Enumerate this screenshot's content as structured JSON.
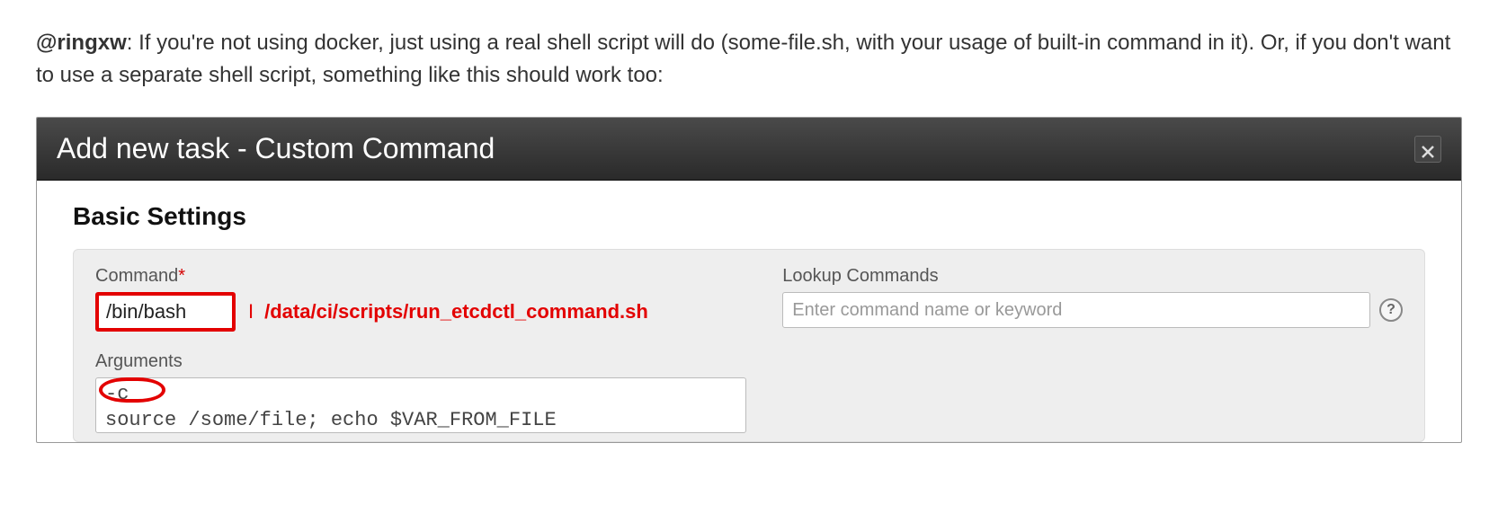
{
  "comment": {
    "mention": "@ringxw",
    "text": ": If you're not using docker, just using a real shell script will do (some-file.sh, with your usage of built-in command in it). Or, if you don't want to use a separate shell script, something like this should work too:"
  },
  "dialog": {
    "title": "Add new task - Custom Command",
    "section_title": "Basic Settings",
    "fields": {
      "command": {
        "label": "Command",
        "required_marker": "*",
        "value": "/bin/bash",
        "annotation_prefix": "I",
        "annotation_path": "/data/ci/scripts/run_etcdctl_command.sh"
      },
      "arguments": {
        "label": "Arguments",
        "value": "-c\nsource /some/file; echo $VAR_FROM_FILE"
      },
      "lookup": {
        "label": "Lookup Commands",
        "placeholder": "Enter command name or keyword",
        "help": "?"
      }
    }
  }
}
